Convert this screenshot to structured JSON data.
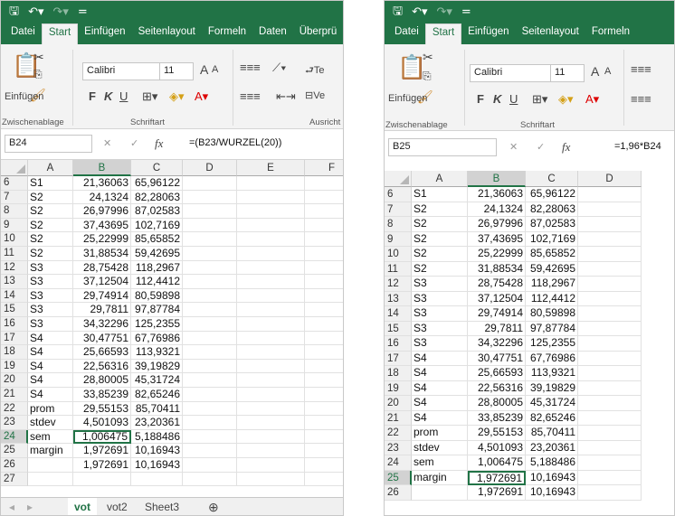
{
  "colors": {
    "accent": "#217346",
    "selection": "#217346"
  },
  "left_window": {
    "quick_access": {
      "save_icon": "save-icon",
      "undo_icon": "undo-icon",
      "redo_icon": "redo-icon",
      "customize_icon": "customize-qat-icon"
    },
    "tabs": [
      "Datei",
      "Start",
      "Einfügen",
      "Seitenlayout",
      "Formeln",
      "Daten",
      "Überprü"
    ],
    "active_tab": "Start",
    "ribbon": {
      "paste_label": "Einfügen",
      "clipboard_group": "Zwischenablage",
      "font_name": "Calibri",
      "font_size": "11",
      "font_group": "Schriftart",
      "alignment_group": "Ausricht",
      "bold": "F",
      "italic": "K",
      "underline": "U",
      "wrap_label": "Te",
      "merge_label": "Ve",
      "grow_font": "A",
      "shrink_font": "A"
    },
    "name_box": "B24",
    "fx": "fx",
    "formula": "=(B23/WURZEL(20))",
    "columns": [
      "A",
      "B",
      "C",
      "D",
      "E",
      "F"
    ],
    "rows": [
      {
        "n": "6",
        "a": "S1",
        "b": "21,36063",
        "c": "65,96122"
      },
      {
        "n": "7",
        "a": "S2",
        "b": "24,1324",
        "c": "82,28063"
      },
      {
        "n": "8",
        "a": "S2",
        "b": "26,97996",
        "c": "87,02583"
      },
      {
        "n": "9",
        "a": "S2",
        "b": "37,43695",
        "c": "102,7169"
      },
      {
        "n": "10",
        "a": "S2",
        "b": "25,22999",
        "c": "85,65852"
      },
      {
        "n": "11",
        "a": "S2",
        "b": "31,88534",
        "c": "59,42695"
      },
      {
        "n": "12",
        "a": "S3",
        "b": "28,75428",
        "c": "118,2967"
      },
      {
        "n": "13",
        "a": "S3",
        "b": "37,12504",
        "c": "112,4412"
      },
      {
        "n": "14",
        "a": "S3",
        "b": "29,74914",
        "c": "80,59898"
      },
      {
        "n": "15",
        "a": "S3",
        "b": "29,7811",
        "c": "97,87784"
      },
      {
        "n": "16",
        "a": "S3",
        "b": "34,32296",
        "c": "125,2355"
      },
      {
        "n": "17",
        "a": "S4",
        "b": "30,47751",
        "c": "67,76986"
      },
      {
        "n": "18",
        "a": "S4",
        "b": "25,66593",
        "c": "113,9321"
      },
      {
        "n": "19",
        "a": "S4",
        "b": "22,56316",
        "c": "39,19829"
      },
      {
        "n": "20",
        "a": "S4",
        "b": "28,80005",
        "c": "45,31724"
      },
      {
        "n": "21",
        "a": "S4",
        "b": "33,85239",
        "c": "82,65246"
      },
      {
        "n": "22",
        "a": "prom",
        "b": "29,55153",
        "c": "85,70411"
      },
      {
        "n": "23",
        "a": "stdev",
        "b": "4,501093",
        "c": "23,20361"
      },
      {
        "n": "24",
        "a": "sem",
        "b": "1,006475",
        "c": "5,188486"
      },
      {
        "n": "25",
        "a": "margin",
        "b": "1,972691",
        "c": "10,16943"
      },
      {
        "n": "26",
        "a": "",
        "b": "1,972691",
        "c": "10,16943"
      },
      {
        "n": "27",
        "a": "",
        "b": "",
        "c": ""
      }
    ],
    "sheets": [
      "vot",
      "vot2",
      "Sheet3"
    ],
    "active_sheet": "vot",
    "add_sheet": "⊕"
  },
  "right_window": {
    "tabs": [
      "Datei",
      "Start",
      "Einfügen",
      "Seitenlayout",
      "Formeln"
    ],
    "active_tab": "Start",
    "ribbon": {
      "paste_label": "Einfügen",
      "clipboard_group": "Zwischenablage",
      "font_name": "Calibri",
      "font_size": "11",
      "font_group": "Schriftart",
      "bold": "F",
      "italic": "K",
      "underline": "U",
      "grow_font": "A",
      "shrink_font": "A"
    },
    "name_box": "B25",
    "fx": "fx",
    "formula": "=1,96*B24",
    "columns": [
      "A",
      "B",
      "C",
      "D"
    ],
    "rows": [
      {
        "n": "6",
        "a": "S1",
        "b": "21,36063",
        "c": "65,96122"
      },
      {
        "n": "7",
        "a": "S2",
        "b": "24,1324",
        "c": "82,28063"
      },
      {
        "n": "8",
        "a": "S2",
        "b": "26,97996",
        "c": "87,02583"
      },
      {
        "n": "9",
        "a": "S2",
        "b": "37,43695",
        "c": "102,7169"
      },
      {
        "n": "10",
        "a": "S2",
        "b": "25,22999",
        "c": "85,65852"
      },
      {
        "n": "11",
        "a": "S2",
        "b": "31,88534",
        "c": "59,42695"
      },
      {
        "n": "12",
        "a": "S3",
        "b": "28,75428",
        "c": "118,2967"
      },
      {
        "n": "13",
        "a": "S3",
        "b": "37,12504",
        "c": "112,4412"
      },
      {
        "n": "14",
        "a": "S3",
        "b": "29,74914",
        "c": "80,59898"
      },
      {
        "n": "15",
        "a": "S3",
        "b": "29,7811",
        "c": "97,87784"
      },
      {
        "n": "16",
        "a": "S3",
        "b": "34,32296",
        "c": "125,2355"
      },
      {
        "n": "17",
        "a": "S4",
        "b": "30,47751",
        "c": "67,76986"
      },
      {
        "n": "18",
        "a": "S4",
        "b": "25,66593",
        "c": "113,9321"
      },
      {
        "n": "19",
        "a": "S4",
        "b": "22,56316",
        "c": "39,19829"
      },
      {
        "n": "20",
        "a": "S4",
        "b": "28,80005",
        "c": "45,31724"
      },
      {
        "n": "21",
        "a": "S4",
        "b": "33,85239",
        "c": "82,65246"
      },
      {
        "n": "22",
        "a": "prom",
        "b": "29,55153",
        "c": "85,70411"
      },
      {
        "n": "23",
        "a": "stdev",
        "b": "4,501093",
        "c": "23,20361"
      },
      {
        "n": "24",
        "a": "sem",
        "b": "1,006475",
        "c": "5,188486"
      },
      {
        "n": "25",
        "a": "margin",
        "b": "1,972691",
        "c": "10,16943"
      },
      {
        "n": "26",
        "a": "",
        "b": "1,972691",
        "c": "10,16943"
      }
    ]
  }
}
